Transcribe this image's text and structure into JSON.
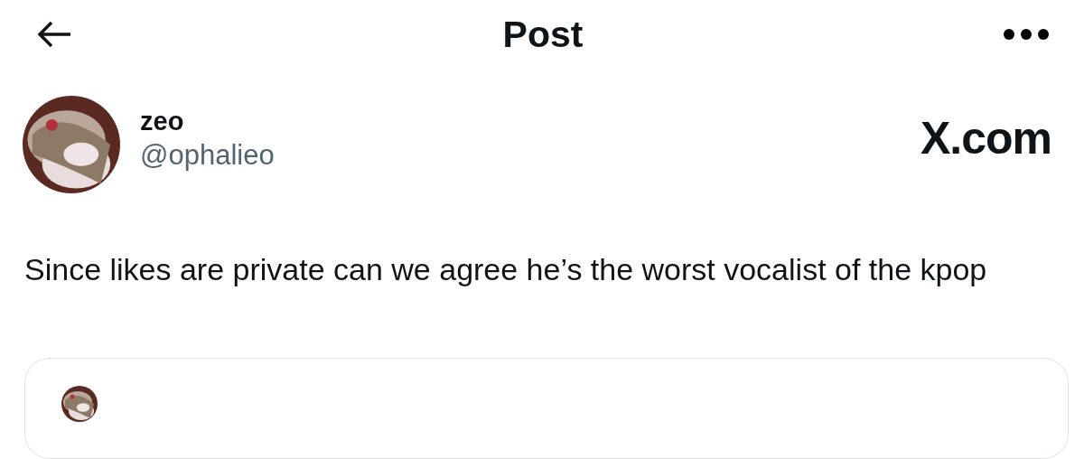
{
  "header": {
    "title": "Post"
  },
  "author": {
    "name": "zeo",
    "handle": "@ophalieo"
  },
  "badge": "X.com",
  "post": {
    "text": "Since likes are private can we agree he’s the worst vocalist of the kpop"
  }
}
